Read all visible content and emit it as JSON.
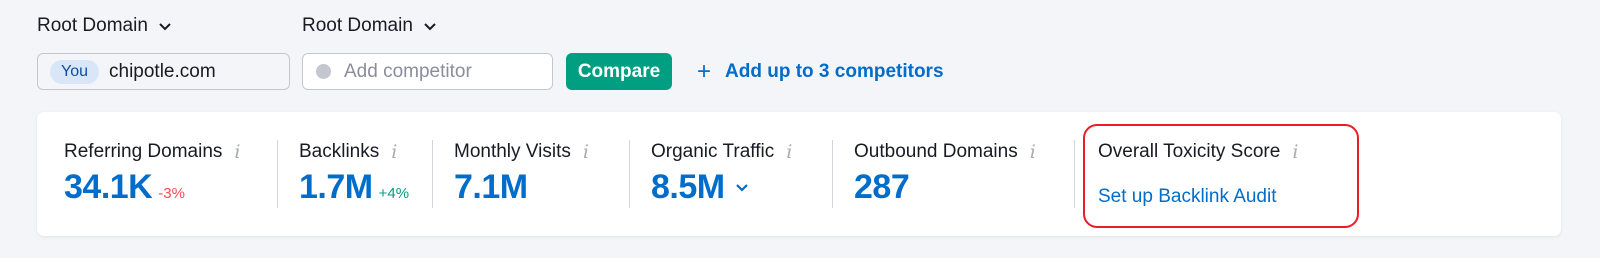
{
  "filters": {
    "you_scope": "Root Domain",
    "competitor_scope": "Root Domain"
  },
  "you": {
    "badge": "You",
    "domain": "chipotle.com"
  },
  "competitor": {
    "placeholder": "Add competitor"
  },
  "compare_label": "Compare",
  "add_competitors": {
    "icon": "plus-icon",
    "label": "Add up to 3 competitors"
  },
  "metrics": [
    {
      "title": "Referring Domains",
      "value": "34.1K",
      "delta": "-3%",
      "delta_color": "#ff4953"
    },
    {
      "title": "Backlinks",
      "value": "1.7M",
      "delta": "+4%",
      "delta_color": "#009f81"
    },
    {
      "title": "Monthly Visits",
      "value": "7.1M"
    },
    {
      "title": "Organic Traffic",
      "value": "8.5M",
      "dropdown_icon": "chevron-down-icon"
    },
    {
      "title": "Outbound Domains",
      "value": "287"
    }
  ],
  "toxicity": {
    "title": "Overall Toxicity Score",
    "link": "Set up Backlink Audit"
  },
  "colors": {
    "accent_blue": "#006dca",
    "compare_green": "#009f81",
    "highlight_red": "#ec1c24"
  }
}
